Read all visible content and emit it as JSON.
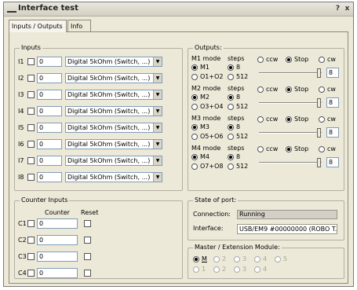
{
  "window": {
    "title": "Interface test",
    "help": "?",
    "close": "x"
  },
  "tabs": [
    {
      "label": "Inputs / Outputs"
    },
    {
      "label": "Info"
    }
  ],
  "inputs": {
    "title": "Inputs",
    "items": [
      {
        "label": "I1",
        "value": "0",
        "mode": "Digital 5kOhm (Switch, ...)"
      },
      {
        "label": "I2",
        "value": "0",
        "mode": "Digital 5kOhm (Switch, ...)"
      },
      {
        "label": "I3",
        "value": "0",
        "mode": "Digital 5kOhm (Switch, ...)"
      },
      {
        "label": "I4",
        "value": "0",
        "mode": "Digital 5kOhm (Switch, ...)"
      },
      {
        "label": "I5",
        "value": "0",
        "mode": "Digital 5kOhm (Switch, ...)"
      },
      {
        "label": "I6",
        "value": "0",
        "mode": "Digital 5kOhm (Switch, ...)"
      },
      {
        "label": "I7",
        "value": "0",
        "mode": "Digital 5kOhm (Switch, ...)"
      },
      {
        "label": "I8",
        "value": "0",
        "mode": "Digital 5kOhm (Switch, ...)"
      }
    ]
  },
  "outputs": {
    "title": "Outputs:",
    "mode_label": "mode",
    "steps_label": "steps",
    "opt_8": "8",
    "opt_512": "512",
    "ccw": "ccw",
    "stop": "Stop",
    "cw": "cw",
    "motors": [
      {
        "name": "M1",
        "single": "M1",
        "pair": "O1+O2",
        "value": "8"
      },
      {
        "name": "M2",
        "single": "M2",
        "pair": "O3+O4",
        "value": "8"
      },
      {
        "name": "M3",
        "single": "M3",
        "pair": "O5+O6",
        "value": "8"
      },
      {
        "name": "M4",
        "single": "M4",
        "pair": "O7+O8",
        "value": "8"
      }
    ]
  },
  "counters": {
    "title": "Counter Inputs",
    "col_counter": "Counter",
    "col_reset": "Reset",
    "items": [
      {
        "label": "C1",
        "value": "0"
      },
      {
        "label": "C2",
        "value": "0"
      },
      {
        "label": "C3",
        "value": "0"
      },
      {
        "label": "C4",
        "value": "0"
      }
    ]
  },
  "state": {
    "title": "State of port:",
    "connection_label": "Connection:",
    "connection_value": "Running",
    "interface_label": "Interface:",
    "interface_value": "USB/EM9 #00000000 (ROBO T."
  },
  "master": {
    "title": "Master / Extension Module:",
    "row1": [
      "M",
      "2",
      "3",
      "4",
      "5"
    ],
    "row2": [
      "1",
      "2",
      "3",
      "4"
    ]
  },
  "colors": {
    "window_bg": "#ece9d8",
    "border": "#8f8b7d",
    "input_border": "#7f9db9",
    "status_bg": "#d4d0c8"
  }
}
